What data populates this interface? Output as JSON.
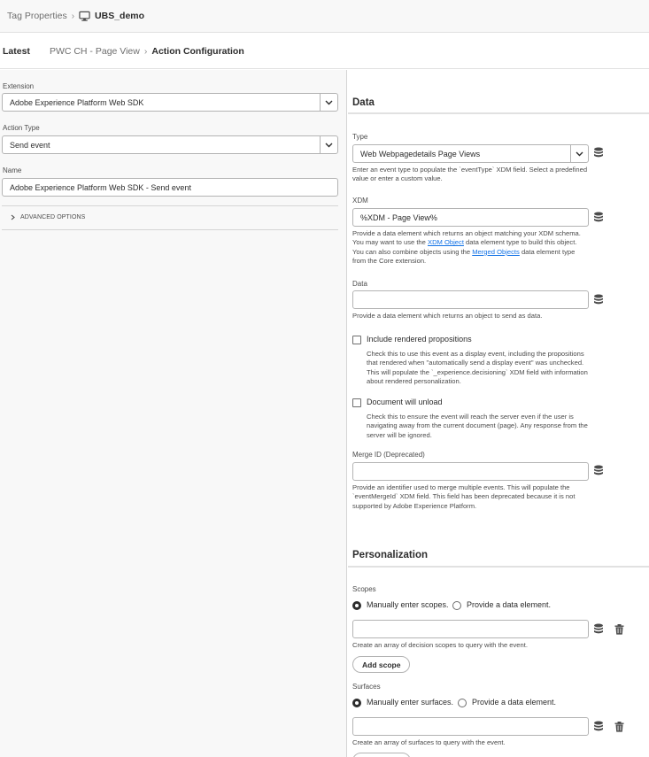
{
  "breadcrumb": {
    "root": "Tag Properties",
    "property": "UBS_demo"
  },
  "subnav": {
    "latest": "Latest",
    "rule": "PWC CH - Page View",
    "current": "Action Configuration"
  },
  "left": {
    "extension": {
      "label": "Extension",
      "value": "Adobe Experience Platform Web SDK"
    },
    "action_type": {
      "label": "Action Type",
      "value": "Send event"
    },
    "name": {
      "label": "Name",
      "value": "Adobe Experience Platform Web SDK - Send event"
    },
    "advanced": "ADVANCED OPTIONS"
  },
  "data_section": {
    "title": "Data",
    "type": {
      "label": "Type",
      "value": "Web Webpagedetails Page Views",
      "help": "Enter an event type to populate the `eventType` XDM field. Select a predefined value or enter a custom value."
    },
    "xdm": {
      "label": "XDM",
      "value": "%XDM - Page View%",
      "help_1": "Provide a data element which returns an object matching your XDM schema. You may want to use the ",
      "link_1": "XDM Object",
      "help_2": " data element type to build this object. You can also combine objects using the ",
      "link_2": "Merged Objects",
      "help_3": " data element type from the Core extension."
    },
    "data": {
      "label": "Data",
      "value": "",
      "help": "Provide a data element which returns an object to send as data."
    },
    "include_rendered": {
      "label": "Include rendered propositions",
      "checked": false,
      "help": "Check this to use this event as a display event, including the propositions that rendered when \"automatically send a display event\" was unchecked. This will populate the `_experience.decisioning` XDM field with information about rendered personalization."
    },
    "doc_unload": {
      "label": "Document will unload",
      "checked": false,
      "help": "Check this to ensure the event will reach the server even if the user is navigating away from the current document (page). Any response from the server will be ignored."
    },
    "merge_id": {
      "label": "Merge ID (Deprecated)",
      "value": "",
      "help": "Provide an identifier used to merge multiple events. This will populate the `eventMergeId` XDM field. This field has been deprecated because it is not supported by Adobe Experience Platform."
    }
  },
  "personalization": {
    "title": "Personalization",
    "scopes": {
      "label": "Scopes",
      "option_manual": "Manually enter scopes.",
      "option_element": "Provide a data element.",
      "selected": "manual",
      "value": "",
      "help": "Create an array of decision scopes to query with the event.",
      "add_button": "Add scope"
    },
    "surfaces": {
      "label": "Surfaces",
      "option_manual": "Manually enter surfaces.",
      "option_element": "Provide a data element.",
      "selected": "manual",
      "value": "",
      "help": "Create an array of surfaces to query with the event."
    }
  }
}
